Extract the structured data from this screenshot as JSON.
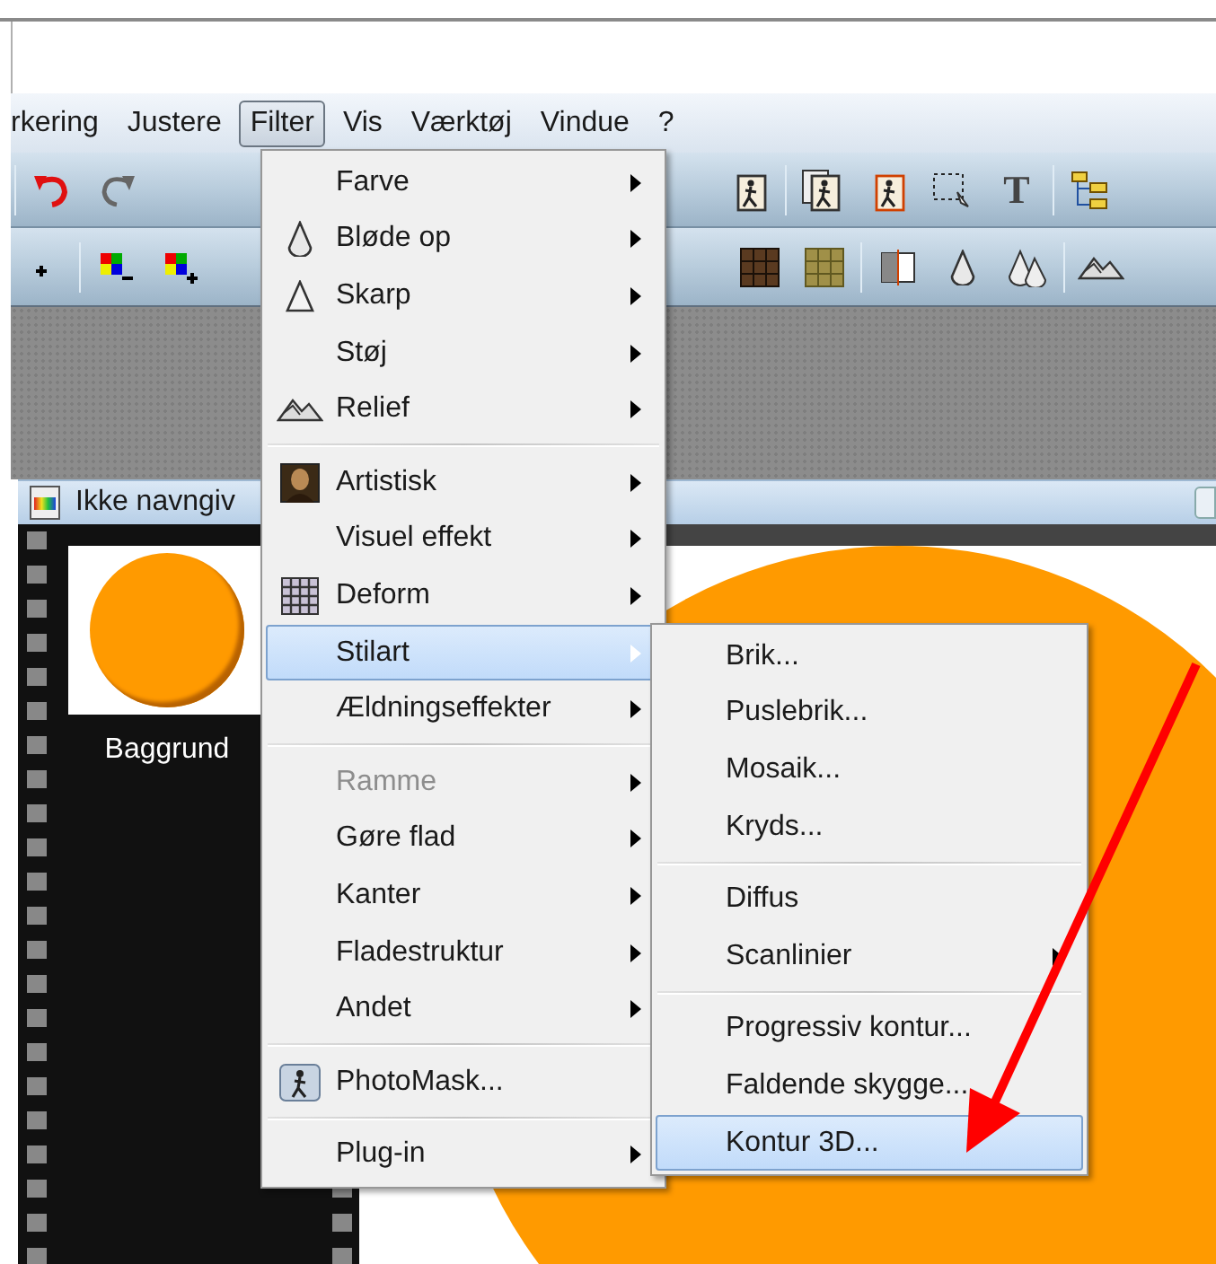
{
  "menubar": [
    {
      "label": "rkering",
      "selected": false
    },
    {
      "label": "Justere",
      "selected": false
    },
    {
      "label": "Filter",
      "selected": true
    },
    {
      "label": "Vis",
      "selected": false
    },
    {
      "label": "Værktøj",
      "selected": false
    },
    {
      "label": "Vindue",
      "selected": false
    },
    {
      "label": "?",
      "selected": false
    }
  ],
  "toolbar": {
    "text_tool": "T"
  },
  "document": {
    "title": "Ikke navngiv",
    "layers": [
      {
        "label": "Baggrund"
      }
    ]
  },
  "filter_menu": [
    {
      "kind": "item",
      "label": "Farve",
      "submenu": true,
      "disabled": false,
      "selected": false
    },
    {
      "kind": "item",
      "label": "Bløde op",
      "submenu": true,
      "disabled": false,
      "selected": false
    },
    {
      "kind": "item",
      "label": "Skarp",
      "submenu": true,
      "disabled": false,
      "selected": false
    },
    {
      "kind": "item",
      "label": "Støj",
      "submenu": true,
      "disabled": false,
      "selected": false
    },
    {
      "kind": "item",
      "label": "Relief",
      "submenu": true,
      "disabled": false,
      "selected": false
    },
    {
      "kind": "separator"
    },
    {
      "kind": "item",
      "label": "Artistisk",
      "submenu": true,
      "disabled": false,
      "selected": false
    },
    {
      "kind": "item",
      "label": "Visuel effekt",
      "submenu": true,
      "disabled": false,
      "selected": false
    },
    {
      "kind": "item",
      "label": "Deform",
      "submenu": true,
      "disabled": false,
      "selected": false
    },
    {
      "kind": "item",
      "label": "Stilart",
      "submenu": true,
      "disabled": false,
      "selected": true
    },
    {
      "kind": "item",
      "label": "Ældningseffekter",
      "submenu": true,
      "disabled": false,
      "selected": false
    },
    {
      "kind": "separator"
    },
    {
      "kind": "item",
      "label": "Ramme",
      "submenu": true,
      "disabled": true,
      "selected": false
    },
    {
      "kind": "item",
      "label": "Gøre flad",
      "submenu": true,
      "disabled": false,
      "selected": false
    },
    {
      "kind": "item",
      "label": "Kanter",
      "submenu": true,
      "disabled": false,
      "selected": false
    },
    {
      "kind": "item",
      "label": "Fladestruktur",
      "submenu": true,
      "disabled": false,
      "selected": false
    },
    {
      "kind": "item",
      "label": "Andet",
      "submenu": true,
      "disabled": false,
      "selected": false
    },
    {
      "kind": "separator"
    },
    {
      "kind": "item",
      "label": "PhotoMask...",
      "submenu": false,
      "disabled": false,
      "selected": false
    },
    {
      "kind": "separator"
    },
    {
      "kind": "item",
      "label": "Plug-in",
      "submenu": true,
      "disabled": false,
      "selected": false
    }
  ],
  "stilart_submenu": [
    {
      "kind": "item",
      "label": "Brik...",
      "submenu": false,
      "disabled": false,
      "selected": false
    },
    {
      "kind": "item",
      "label": "Puslebrik...",
      "submenu": false,
      "disabled": false,
      "selected": false
    },
    {
      "kind": "item",
      "label": "Mosaik...",
      "submenu": false,
      "disabled": false,
      "selected": false
    },
    {
      "kind": "item",
      "label": "Kryds...",
      "submenu": false,
      "disabled": false,
      "selected": false
    },
    {
      "kind": "separator"
    },
    {
      "kind": "item",
      "label": "Diffus",
      "submenu": false,
      "disabled": false,
      "selected": false
    },
    {
      "kind": "item",
      "label": "Scanlinier",
      "submenu": true,
      "disabled": false,
      "selected": false
    },
    {
      "kind": "separator"
    },
    {
      "kind": "item",
      "label": "Progressiv kontur...",
      "submenu": false,
      "disabled": false,
      "selected": false
    },
    {
      "kind": "item",
      "label": "Faldende skygge...",
      "submenu": false,
      "disabled": false,
      "selected": false
    },
    {
      "kind": "item",
      "label": "Kontur 3D...",
      "submenu": false,
      "disabled": false,
      "selected": true
    }
  ]
}
